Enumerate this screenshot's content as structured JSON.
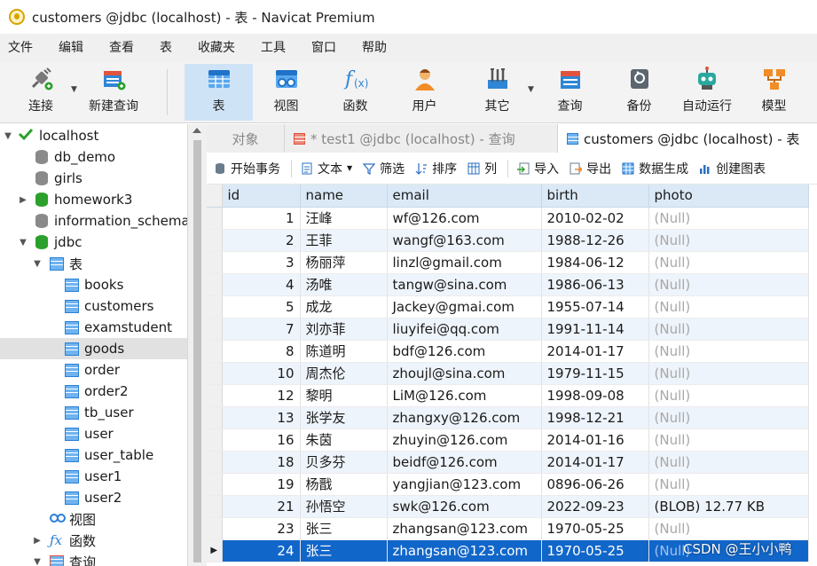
{
  "window": {
    "title": "customers @jdbc (localhost) - 表 - Navicat Premium"
  },
  "menu": [
    "文件",
    "编辑",
    "查看",
    "表",
    "收藏夹",
    "工具",
    "窗口",
    "帮助"
  ],
  "toolbar": {
    "connect": "连接",
    "new_query": "新建查询",
    "table": "表",
    "view": "视图",
    "function": "函数",
    "user": "用户",
    "other": "其它",
    "query": "查询",
    "backup": "备份",
    "automation": "自动运行",
    "model": "模型"
  },
  "tree": {
    "localhost": "localhost",
    "db_demo": "db_demo",
    "girls": "girls",
    "homework3": "homework3",
    "information_schema": "information_schema",
    "jdbc": "jdbc",
    "tables_group": "表",
    "tables": [
      "books",
      "customers",
      "examstudent",
      "goods",
      "order",
      "order2",
      "tb_user",
      "user",
      "user_table",
      "user1",
      "user2"
    ],
    "views_group": "视图",
    "functions_group": "函数",
    "queries_group": "查询"
  },
  "tabs": {
    "objects": "对象",
    "query_tab": "* test1 @jdbc (localhost) - 查询",
    "table_tab": "customers @jdbc (localhost) - 表"
  },
  "data_toolbar": {
    "begin_transaction": "开始事务",
    "text": "文本",
    "filter": "筛选",
    "sort": "排序",
    "columns": "列",
    "import": "导入",
    "export": "导出",
    "data_generation": "数据生成",
    "create_chart": "创建图表"
  },
  "grid": {
    "columns": [
      "id",
      "name",
      "email",
      "birth",
      "photo"
    ],
    "rows": [
      [
        "1",
        "汪峰",
        "wf@126.com",
        "2010-02-02",
        "(Null)"
      ],
      [
        "2",
        "王菲",
        "wangf@163.com",
        "1988-12-26",
        "(Null)"
      ],
      [
        "3",
        "杨丽萍",
        "linzl@gmail.com",
        "1984-06-12",
        "(Null)"
      ],
      [
        "4",
        "汤唯",
        "tangw@sina.com",
        "1986-06-13",
        "(Null)"
      ],
      [
        "5",
        "成龙",
        "Jackey@gmai.com",
        "1955-07-14",
        "(Null)"
      ],
      [
        "7",
        "刘亦菲",
        "liuyifei@qq.com",
        "1991-11-14",
        "(Null)"
      ],
      [
        "8",
        "陈道明",
        "bdf@126.com",
        "2014-01-17",
        "(Null)"
      ],
      [
        "10",
        "周杰伦",
        "zhoujl@sina.com",
        "1979-11-15",
        "(Null)"
      ],
      [
        "12",
        "黎明",
        "LiM@126.com",
        "1998-09-08",
        "(Null)"
      ],
      [
        "13",
        "张学友",
        "zhangxy@126.com",
        "1998-12-21",
        "(Null)"
      ],
      [
        "16",
        "朱茵",
        "zhuyin@126.com",
        "2014-01-16",
        "(Null)"
      ],
      [
        "18",
        "贝多芬",
        "beidf@126.com",
        "2014-01-17",
        "(Null)"
      ],
      [
        "19",
        "杨戬",
        "yangjian@123.com",
        "0896-06-26",
        "(Null)"
      ],
      [
        "21",
        "孙悟空",
        "swk@126.com",
        "2022-09-23",
        "(BLOB) 12.77 KB"
      ],
      [
        "23",
        "张三",
        "zhangsan@123.com",
        "1970-05-25",
        "(Null)"
      ],
      [
        "24",
        "张三",
        "zhangsan@123.com",
        "1970-05-25",
        "(Null)"
      ]
    ],
    "current_row_marker": "▶"
  },
  "watermark": "CSDN @王小小鸭"
}
